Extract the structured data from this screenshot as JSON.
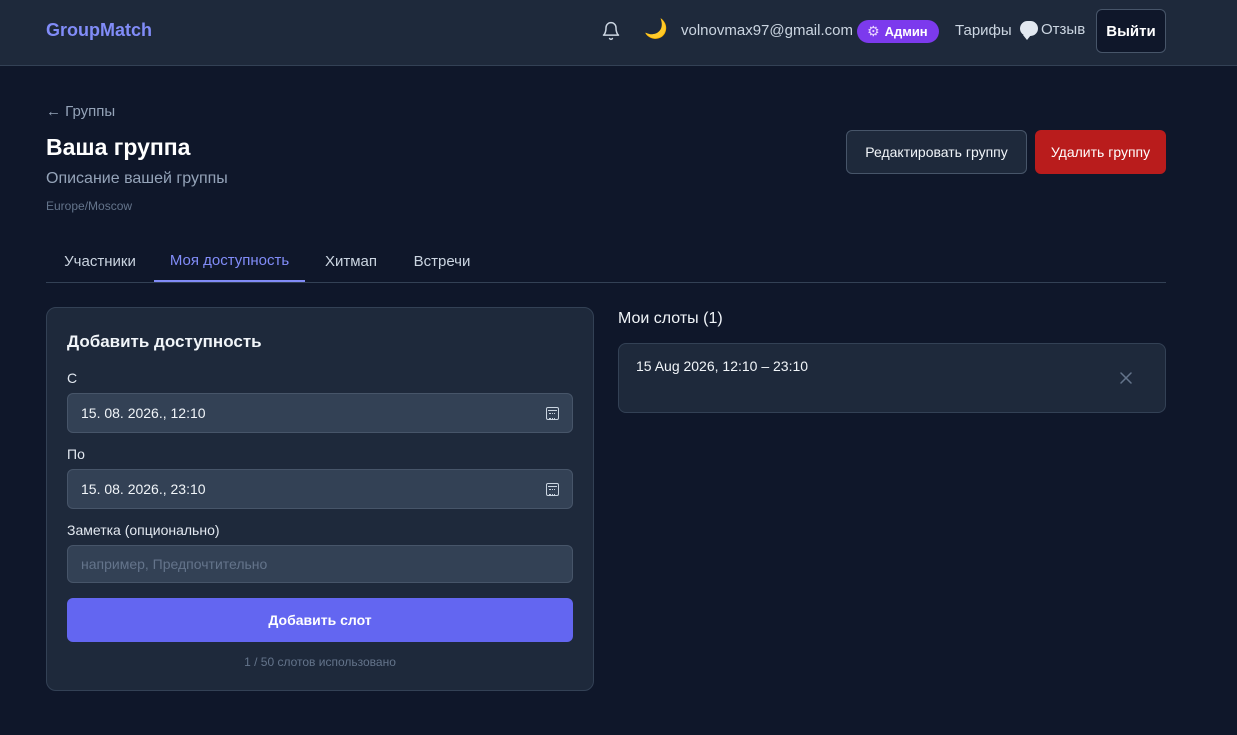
{
  "header": {
    "brand": "GroupMatch",
    "email": "volnovmax97@gmail.com",
    "admin_badge": "Админ",
    "tariffs": "Тарифы",
    "feedback": "Отзыв",
    "logout": "Выйти"
  },
  "group": {
    "back": "← Группы",
    "title": "Ваша группа",
    "description": "Описание вашей группы",
    "timezone": "Europe/Moscow",
    "edit_button": "Редактировать группу",
    "delete_button": "Удалить группу"
  },
  "tabs": [
    {
      "label": "Участники"
    },
    {
      "label": "Моя доступность"
    },
    {
      "label": "Хитмап"
    },
    {
      "label": "Встречи"
    }
  ],
  "availability_form": {
    "title": "Добавить доступность",
    "from_label": "С",
    "from_value": "15. 08. 2026., 12:10",
    "to_label": "По",
    "to_value": "15. 08. 2026., 23:10",
    "note_label": "Заметка (опционально)",
    "note_placeholder": "например, Предпочтительно",
    "submit": "Добавить слот",
    "usage": "1 / 50 слотов использовано"
  },
  "slots": {
    "title": "Мои слоты (1)",
    "items": [
      {
        "range": "15 Aug 2026, 12:10 – 23:10"
      }
    ]
  },
  "colors": {
    "accent": "#6366f1",
    "danger": "#b91c1c",
    "admin": "#7c3aed",
    "background": "#0f172a"
  },
  "icons": [
    "bell-icon",
    "moon-icon",
    "gear-icon",
    "speech-bubble-icon",
    "calendar-icon",
    "close-icon"
  ]
}
